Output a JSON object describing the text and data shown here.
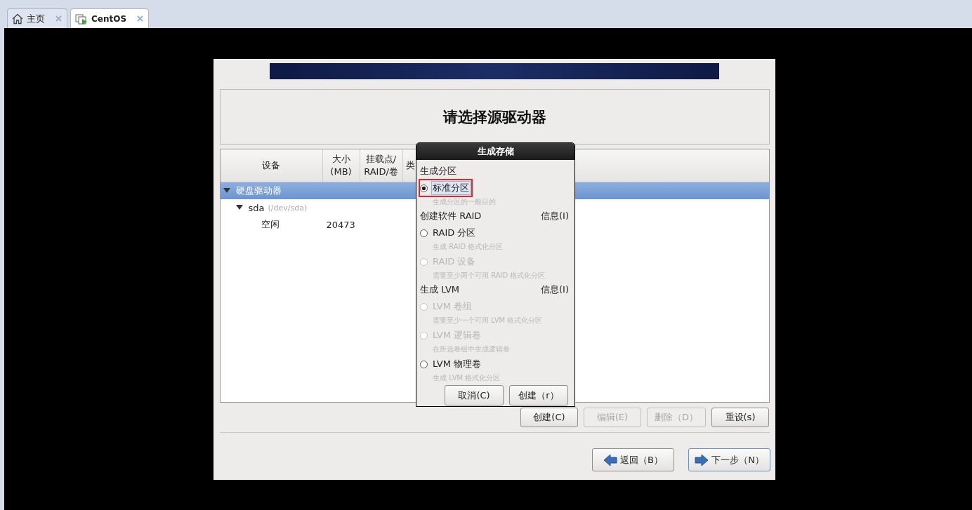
{
  "tabs": [
    {
      "label": "主页",
      "selected": false
    },
    {
      "label": "CentOS",
      "selected": true
    }
  ],
  "installer": {
    "title": "请选择源驱动器",
    "table": {
      "columns": [
        "设备",
        "大小\n(MB)",
        "挂载点/\nRAID/卷",
        "类"
      ],
      "rows": [
        {
          "label": "硬盘驱动器",
          "expanded": true,
          "selected": true,
          "children": [
            {
              "label": "sda",
              "detail": "(/dev/sda)",
              "expanded": true,
              "selected": false,
              "children": [
                {
                  "label": "空闲",
                  "size": "20473",
                  "selected": false
                }
              ]
            }
          ]
        }
      ]
    },
    "actions": [
      {
        "label": "创建(C)",
        "disabled": false
      },
      {
        "label": "编辑(E)",
        "disabled": true
      },
      {
        "label": "删除（D）",
        "disabled": true
      },
      {
        "label": "重设(s)",
        "disabled": false
      }
    ],
    "nav": [
      {
        "label": "返回（B）",
        "focused": false
      },
      {
        "label": "下一步（N）",
        "focused": true
      }
    ]
  },
  "dialog": {
    "title": "生成存储",
    "sections": [
      {
        "heading": "生成分区",
        "options": [
          {
            "label": "标准分区",
            "hint": "生成分区的一般目的",
            "selected": true,
            "disabled": false,
            "highlighted": true
          }
        ]
      },
      {
        "heading": "创建软件 RAID",
        "info": "信息(I)",
        "options": [
          {
            "label": "RAID 分区",
            "hint": "生成 RAID 格式化分区",
            "selected": false,
            "disabled": false,
            "highlighted": false
          },
          {
            "label": "RAID 设备",
            "hint": "需要至少两个可用 RAID 格式化分区",
            "selected": false,
            "disabled": true,
            "highlighted": false
          }
        ]
      },
      {
        "heading": "生成 LVM",
        "info": "信息(I)",
        "options": [
          {
            "label": "LVM 卷组",
            "hint": "需要至少一个可用 LVM 格式化分区",
            "selected": false,
            "disabled": true,
            "highlighted": false
          },
          {
            "label": "LVM 逻辑卷",
            "hint": "在所选卷组中生成逻辑卷",
            "selected": false,
            "disabled": true,
            "highlighted": false
          },
          {
            "label": "LVM 物理卷",
            "hint": "生成 LVM 格式化分区",
            "selected": false,
            "disabled": false,
            "highlighted": false
          }
        ]
      }
    ],
    "buttons": [
      "取消(C)",
      "创建（r）"
    ]
  }
}
